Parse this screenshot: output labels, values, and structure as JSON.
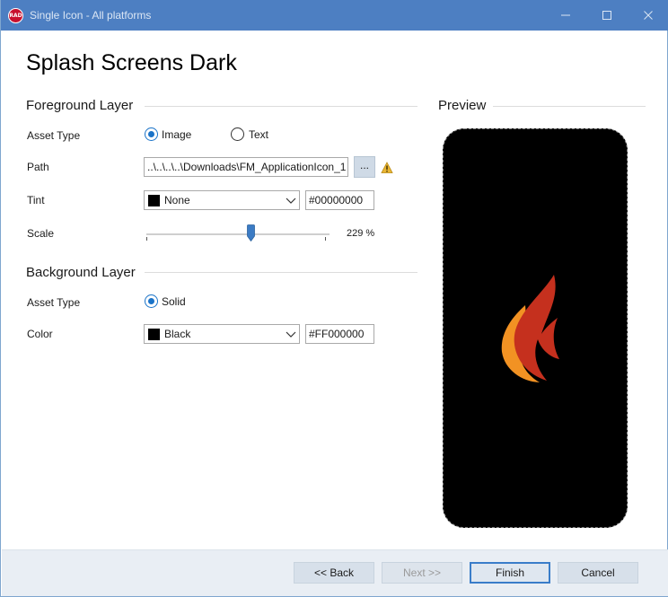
{
  "window": {
    "app_icon_text": "RAD",
    "title": "Single Icon - All platforms"
  },
  "page": {
    "title": "Splash Screens Dark"
  },
  "foreground": {
    "header": "Foreground Layer",
    "asset_type_label": "Asset Type",
    "asset_type_options": [
      "Image",
      "Text"
    ],
    "asset_type_selected": "Image",
    "path_label": "Path",
    "path_value": "..\\..\\..\\..\\Downloads\\FM_ApplicationIcon_1",
    "browse_label": "...",
    "tint_label": "Tint",
    "tint_color_name": "None",
    "tint_hex": "#00000000",
    "scale_label": "Scale",
    "scale_value_text": "229 %",
    "scale_fraction": 0.57
  },
  "background": {
    "header": "Background Layer",
    "asset_type_label": "Asset Type",
    "asset_type_option": "Solid",
    "color_label": "Color",
    "color_name": "Black",
    "color_hex": "#FF000000"
  },
  "preview": {
    "header": "Preview"
  },
  "footer": {
    "back_label": "<< Back",
    "next_label": "Next >>",
    "finish_label": "Finish",
    "cancel_label": "Cancel"
  },
  "icons": [
    "app-icon",
    "minimize-icon",
    "maximize-icon",
    "close-icon",
    "warning-icon",
    "chevron-down-icon",
    "flame-icon"
  ],
  "colors": {
    "titlebar": "#4d7fc2",
    "accent": "#1a73c8",
    "preview_background": "#000000",
    "flame_orange": "#f29223",
    "flame_red": "#c5301e"
  }
}
